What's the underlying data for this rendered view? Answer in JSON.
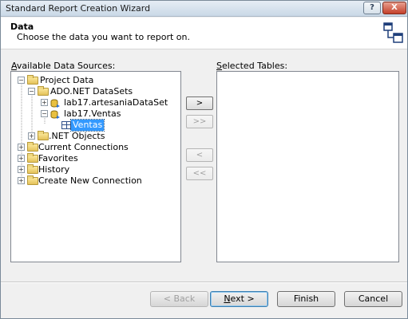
{
  "window": {
    "title": "Standard Report Creation Wizard",
    "help_glyph": "?",
    "close_glyph": "X"
  },
  "header": {
    "title": "Data",
    "subtitle": "Choose the data you want to report on."
  },
  "available": {
    "label_accel": "A",
    "label_rest": "vailable Data Sources:",
    "tree": [
      {
        "label": "Project Data",
        "icon": "folder-icon",
        "expander": "minus"
      },
      {
        "label": "ADO.NET DataSets",
        "icon": "folder-icon",
        "expander": "minus"
      },
      {
        "label": "lab17.artesaniaDataSet",
        "icon": "dataset-icon",
        "expander": "plus"
      },
      {
        "label": "lab17.Ventas",
        "icon": "dataset-icon",
        "expander": "minus"
      },
      {
        "label": "Ventas",
        "icon": "table-icon",
        "selected": true
      },
      {
        "label": ".NET Objects",
        "icon": "folder-icon",
        "expander": "plus"
      },
      {
        "label": "Current Connections",
        "icon": "folder-icon",
        "expander": "plus"
      },
      {
        "label": "Favorites",
        "icon": "folder-icon",
        "expander": "plus"
      },
      {
        "label": "History",
        "icon": "folder-icon",
        "expander": "plus"
      },
      {
        "label": "Create New Connection",
        "icon": "folder-icon",
        "expander": "plus"
      }
    ]
  },
  "selected": {
    "label_accel": "S",
    "label_rest": "elected Tables:"
  },
  "transfer_buttons": {
    "add": ">",
    "add_all": ">>",
    "remove": "<",
    "remove_all": "<<"
  },
  "footer": {
    "back": "< Back",
    "next_accel": "N",
    "next_rest": "ext >",
    "finish": "Finish",
    "cancel": "Cancel"
  },
  "colors": {
    "selection": "#3399ff",
    "close_button": "#c4402a"
  }
}
